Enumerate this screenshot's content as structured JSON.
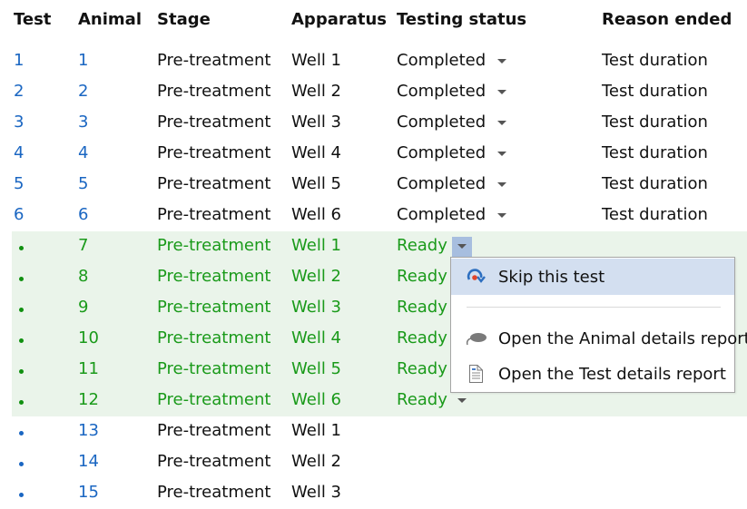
{
  "columns": {
    "test": "Test",
    "animal": "Animal",
    "stage": "Stage",
    "apparatus": "Apparatus",
    "testing_status": "Testing status",
    "reason_ended": "Reason ended"
  },
  "rows": [
    {
      "test": "1",
      "animal": "1",
      "stage": "Pre-treatment",
      "apparatus": "Well 1",
      "status": "Completed",
      "reason": "Test duration",
      "state": "completed"
    },
    {
      "test": "2",
      "animal": "2",
      "stage": "Pre-treatment",
      "apparatus": "Well 2",
      "status": "Completed",
      "reason": "Test duration",
      "state": "completed"
    },
    {
      "test": "3",
      "animal": "3",
      "stage": "Pre-treatment",
      "apparatus": "Well 3",
      "status": "Completed",
      "reason": "Test duration",
      "state": "completed"
    },
    {
      "test": "4",
      "animal": "4",
      "stage": "Pre-treatment",
      "apparatus": "Well 4",
      "status": "Completed",
      "reason": "Test duration",
      "state": "completed"
    },
    {
      "test": "5",
      "animal": "5",
      "stage": "Pre-treatment",
      "apparatus": "Well 5",
      "status": "Completed",
      "reason": "Test duration",
      "state": "completed"
    },
    {
      "test": "6",
      "animal": "6",
      "stage": "Pre-treatment",
      "apparatus": "Well 6",
      "status": "Completed",
      "reason": "Test duration",
      "state": "completed"
    },
    {
      "test": "•",
      "animal": "7",
      "stage": "Pre-treatment",
      "apparatus": "Well 1",
      "status": "Ready",
      "reason": "",
      "state": "ready"
    },
    {
      "test": "•",
      "animal": "8",
      "stage": "Pre-treatment",
      "apparatus": "Well 2",
      "status": "Ready",
      "reason": "",
      "state": "ready"
    },
    {
      "test": "•",
      "animal": "9",
      "stage": "Pre-treatment",
      "apparatus": "Well 3",
      "status": "Ready",
      "reason": "",
      "state": "ready"
    },
    {
      "test": "•",
      "animal": "10",
      "stage": "Pre-treatment",
      "apparatus": "Well 4",
      "status": "Ready",
      "reason": "",
      "state": "ready"
    },
    {
      "test": "•",
      "animal": "11",
      "stage": "Pre-treatment",
      "apparatus": "Well 5",
      "status": "Ready",
      "reason": "",
      "state": "ready"
    },
    {
      "test": "•",
      "animal": "12",
      "stage": "Pre-treatment",
      "apparatus": "Well 6",
      "status": "Ready",
      "reason": "",
      "state": "ready"
    },
    {
      "test": "•",
      "animal": "13",
      "stage": "Pre-treatment",
      "apparatus": "Well 1",
      "status": "",
      "reason": "",
      "state": "pending"
    },
    {
      "test": "•",
      "animal": "14",
      "stage": "Pre-treatment",
      "apparatus": "Well 2",
      "status": "",
      "reason": "",
      "state": "pending"
    },
    {
      "test": "•",
      "animal": "15",
      "stage": "Pre-treatment",
      "apparatus": "Well 3",
      "status": "",
      "reason": "",
      "state": "pending"
    }
  ],
  "context_menu": {
    "open_for_row": 7,
    "items": [
      {
        "label": "Skip this test",
        "icon": "skip-icon",
        "highlighted": true
      },
      {
        "label": "Open the Animal details report",
        "icon": "animal-icon",
        "highlighted": false
      },
      {
        "label": "Open the Test details report",
        "icon": "document-icon",
        "highlighted": false
      }
    ]
  },
  "colors": {
    "link_blue": "#1a66c2",
    "ready_green": "#1a9a1a",
    "active_row_bg": "#eaf4ea",
    "menu_highlight": "#d3dff0",
    "dropdown_open_bg": "#a7bedf"
  }
}
